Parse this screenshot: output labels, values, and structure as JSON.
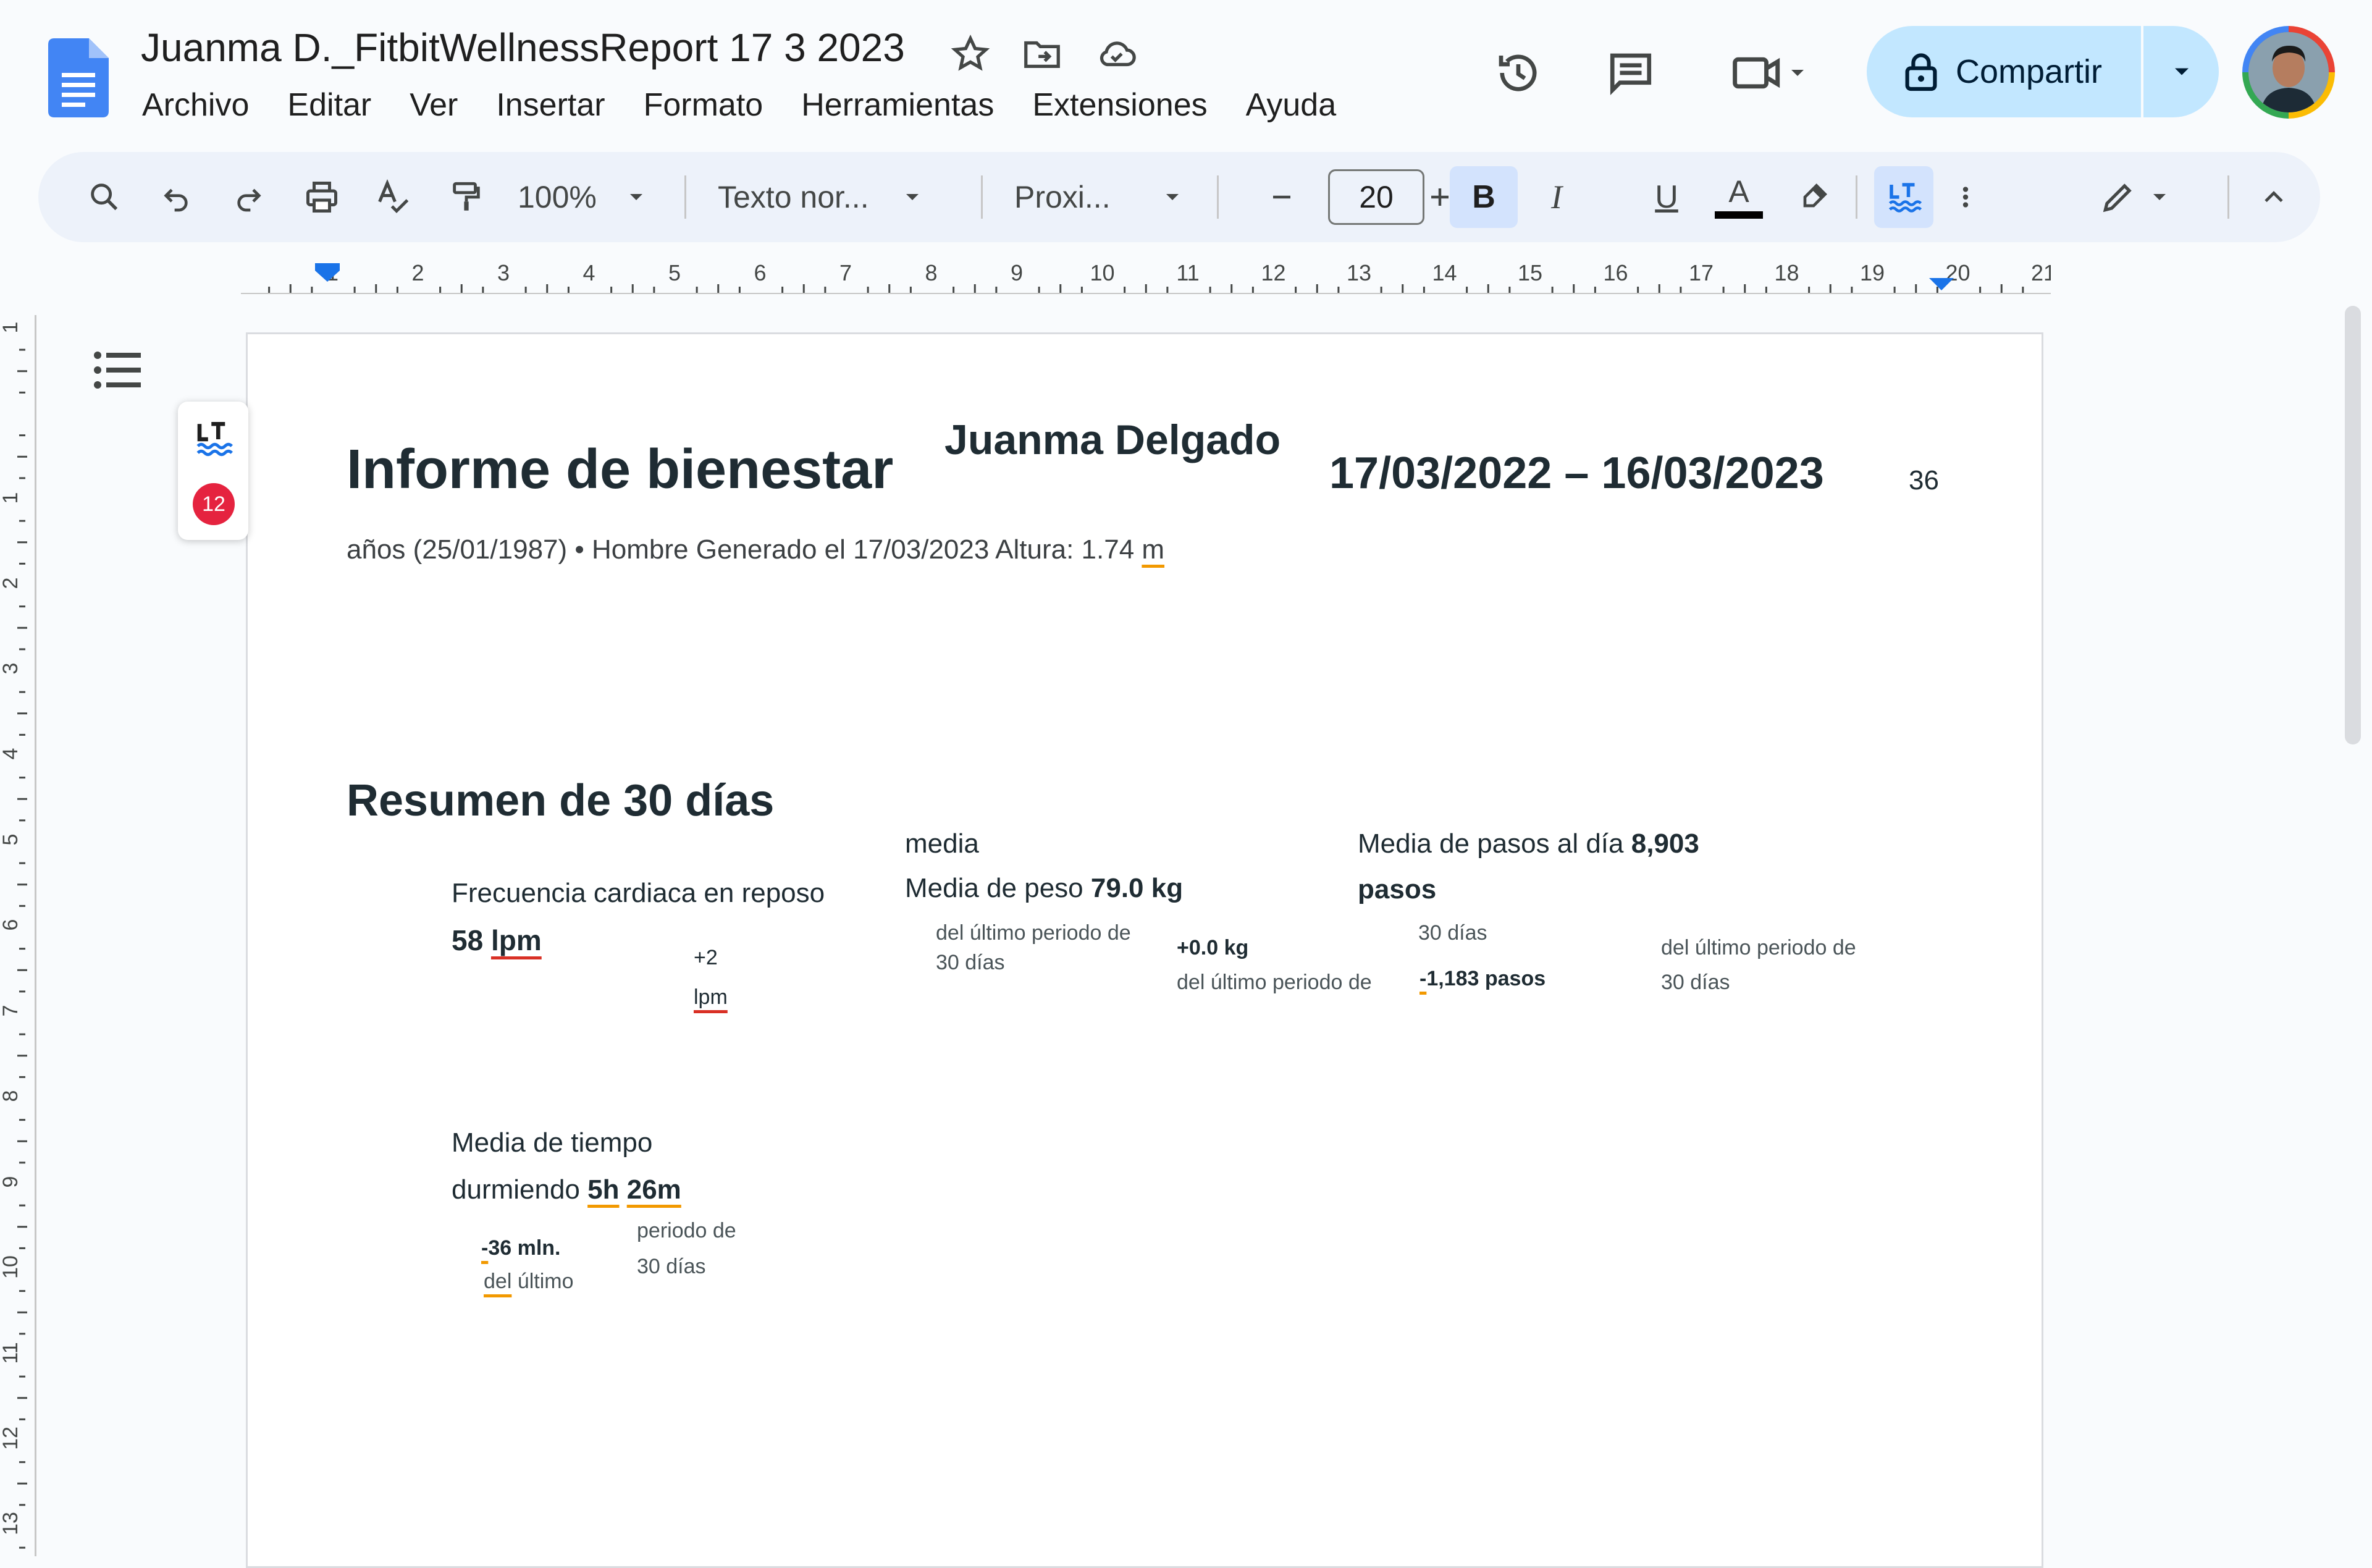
{
  "header": {
    "title": "Juanma D._FitbitWellnessReport 17 3 2023",
    "menu": [
      "Archivo",
      "Editar",
      "Ver",
      "Insertar",
      "Formato",
      "Herramientas",
      "Extensiones",
      "Ayuda"
    ],
    "share_label": "Compartir"
  },
  "toolbar": {
    "zoom": "100%",
    "style": "Texto nor...",
    "font": "Proxi...",
    "font_size": "20",
    "bold": "B",
    "italic": "I",
    "underline": "U",
    "text_color": "A",
    "text_color_value": "#000000"
  },
  "ruler": {
    "h_labels": [
      "1",
      "2",
      "3",
      "4",
      "5",
      "6",
      "7",
      "8",
      "9",
      "10",
      "11",
      "12",
      "13",
      "14",
      "15",
      "16",
      "17",
      "18",
      "19",
      "20",
      "21"
    ],
    "v_labels": [
      "1",
      "1",
      "2",
      "3",
      "4",
      "5",
      "6",
      "7",
      "8",
      "9",
      "10",
      "11",
      "12",
      "13"
    ]
  },
  "languagetool": {
    "logo": "LT",
    "count": "12"
  },
  "document": {
    "title": "Informe de bienestar",
    "name": "Juanma Delgado",
    "date_range": "17/03/2022 – 16/03/2023",
    "age_num": "36",
    "meta_line_prefix": "años (25/01/1987) • Hombre Generado el 17/03/2023 Altura: 1.74 ",
    "meta_line_unit": "m",
    "section_title": "Resumen de 30 días",
    "hr": {
      "label": "Frecuencia cardiaca en reposo",
      "value": "58 ",
      "unit": "lpm",
      "change_value": "+2",
      "change_unit": "lpm"
    },
    "weight": {
      "pre_label": "media",
      "label": "Media de peso ",
      "value": "79.0 kg",
      "period_1": "del último periodo de",
      "period_2": "30 días",
      "change": "+0.0 kg",
      "period_3": "del último periodo de"
    },
    "steps": {
      "label": "Media de pasos al día ",
      "value": "8,903",
      "unit": "pasos",
      "period_days": "30 días",
      "change_dash": "-",
      "change": "1,183 pasos",
      "period_1": "del último periodo de",
      "period_2": "30 días"
    },
    "sleep": {
      "label_1": "Media de tiempo",
      "label_2": "durmiendo ",
      "value_h": "5h",
      "value_m": "26m",
      "change_dash": "-",
      "change": "36 mln.",
      "period_a": "del",
      "period_b": " último",
      "period_c": "periodo de",
      "period_d": "30 días"
    }
  },
  "colors": {
    "accent": "#0b57d0",
    "share_bg": "#c2e7ff",
    "toolbar_bg": "#edf2fa",
    "active_bg": "#d3e3fd",
    "spell_red": "#d93025",
    "grammar_orange": "#f29900"
  }
}
